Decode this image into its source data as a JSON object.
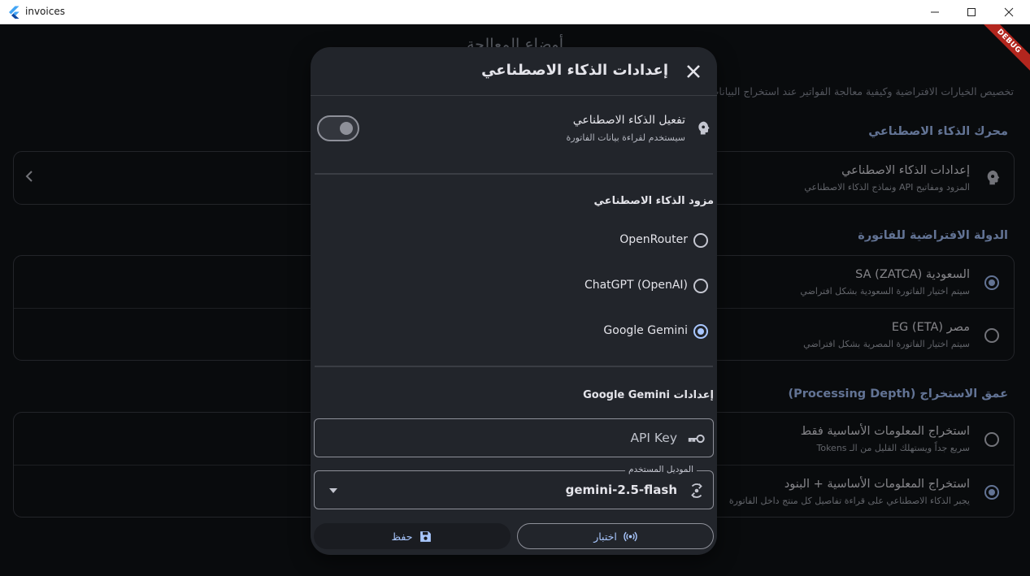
{
  "window": {
    "title": "invoices"
  },
  "background": {
    "page_title": "أوضاع المعالجة",
    "description": "تخصيص الخيارات الافتراضية وكيفية معالجة الفواتير عند استخراج البيانات",
    "debug_banner": "DEBUG",
    "ai_engine": {
      "section_title": "محرك الذكاء الاصطناعي",
      "item": {
        "title": "إعدادات الذكاء الاصطناعي",
        "subtitle": "المزود ومفاتيح API ونماذج الذكاء الاصطناعي",
        "icon": "robot-icon"
      }
    },
    "default_country": {
      "section_title": "الدولة الافتراضية للفاتورة",
      "options": [
        {
          "title": "السعودية (ZATCA) SA",
          "subtitle": "سيتم اختيار الفاتورة السعودية بشكل افتراضي",
          "checked": true
        },
        {
          "title": "مصر (ETA) EG",
          "subtitle": "سيتم اختيار الفاتورة المصرية بشكل افتراضي",
          "checked": false
        }
      ]
    },
    "processing_depth": {
      "section_title": "عمق الاستخراج (Processing Depth)",
      "options": [
        {
          "title": "استخراج المعلومات الأساسية فقط",
          "subtitle": "سريع جداً ويستهلك القليل من الـ Tokens",
          "checked": false
        },
        {
          "title": "استخراج المعلومات الأساسية + البنود",
          "subtitle": "يجبر الذكاء الاصطناعي على قراءة تفاصيل كل منتج داخل الفاتورة",
          "checked": true
        }
      ]
    }
  },
  "dialog": {
    "title": "إعدادات الذكاء الاصطناعي",
    "enable": {
      "title": "تفعيل الذكاء الاصطناعي",
      "subtitle": "سيستخدم لقراءة بيانات الفاتورة",
      "enabled": false
    },
    "provider": {
      "label": "مزود الذكاء الاصطناعي",
      "options": [
        {
          "label": "OpenRouter",
          "checked": false
        },
        {
          "label": "ChatGPT (OpenAI)",
          "checked": false
        },
        {
          "label": "Google Gemini",
          "checked": true
        }
      ]
    },
    "provider_settings_label": "إعدادات Google Gemini",
    "api_key": {
      "placeholder": "API Key",
      "icon": "key-icon"
    },
    "model": {
      "label": "الموديل المستخدم",
      "value": "gemini-2.5-flash",
      "icon": "model-switch-icon"
    },
    "buttons": {
      "save": "حفظ",
      "test": "اختبار"
    }
  },
  "colors": {
    "accent": "#a9c7ff",
    "surface": "#22252b",
    "background": "#111318"
  }
}
